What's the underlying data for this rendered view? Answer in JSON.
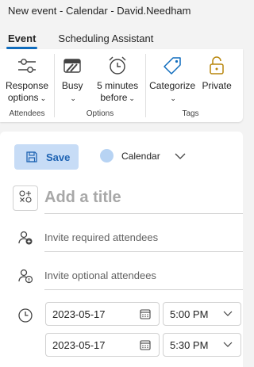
{
  "window": {
    "title": "New event - Calendar - David.Needham"
  },
  "tabs": [
    {
      "label": "Event",
      "active": true
    },
    {
      "label": "Scheduling Assistant",
      "active": false
    }
  ],
  "ribbon": {
    "groups": [
      {
        "label": "Attendees",
        "buttons": [
          {
            "icon": "sliders-icon",
            "line1": "Response",
            "line2": "options"
          }
        ]
      },
      {
        "label": "Options",
        "buttons": [
          {
            "icon": "busy-icon",
            "line1": "Busy",
            "line2": ""
          },
          {
            "icon": "alarm-clock-icon",
            "line1": "5 minutes",
            "line2": "before"
          }
        ]
      },
      {
        "label": "Tags",
        "buttons": [
          {
            "icon": "tag-icon",
            "line1": "Categorize",
            "line2": ""
          },
          {
            "icon": "lock-icon",
            "line1": "Private",
            "line2": ""
          }
        ]
      }
    ]
  },
  "toolbar": {
    "save_label": "Save",
    "calendar_label": "Calendar",
    "calendar_color": "#b7d3f3"
  },
  "form": {
    "title_placeholder": "Add a title",
    "required_placeholder": "Invite required attendees",
    "optional_placeholder": "Invite optional attendees",
    "start_date": "2023-05-17",
    "start_time": "5:00 PM",
    "end_date": "2023-05-17",
    "end_time": "5:30 PM"
  },
  "colors": {
    "accent": "#0f6cbd",
    "save_bg": "#c7dcf6",
    "save_text": "#1e63b3",
    "private_icon": "#b8860b"
  }
}
